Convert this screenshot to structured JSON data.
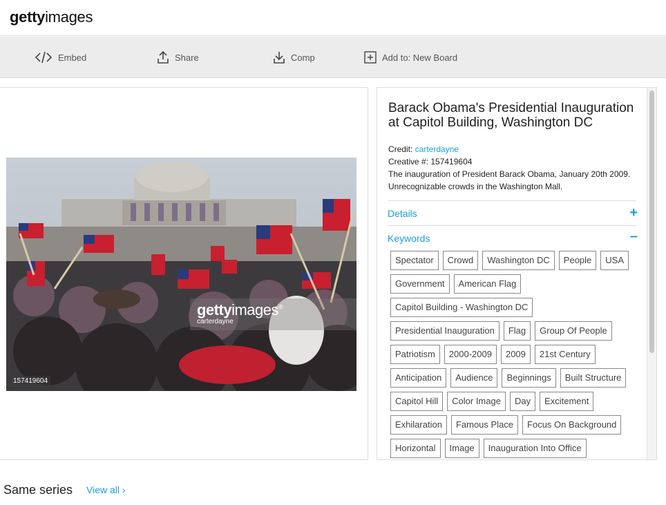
{
  "header": {
    "logo_bold": "getty",
    "logo_light": "images"
  },
  "toolbar": {
    "embed_label": "Embed",
    "share_label": "Share",
    "comp_label": "Comp",
    "board_label": "Add to: New Board"
  },
  "image": {
    "watermark_bold": "getty",
    "watermark_light": "images",
    "watermark_reg": "®",
    "watermark_credit": "carterdayne",
    "id_badge": "157419604"
  },
  "info": {
    "title": "Barack Obama's Presidential Inauguration at Capitol Building, Washington DC",
    "credit_label": "Credit: ",
    "credit_value": "carterdayne",
    "creative_label": "Creative #: ",
    "creative_value": "157419604",
    "description": "The inauguration of President Barack Obama, January 20th 2009. Unrecognizable crowds in the Washington Mall.",
    "details_label": "Details",
    "details_toggle": "+",
    "keywords_label": "Keywords",
    "keywords_toggle": "–"
  },
  "keywords": [
    [
      "Spectator",
      "Crowd",
      "Washington DC",
      "People",
      "USA"
    ],
    [
      "Government",
      "American Flag"
    ],
    [
      "Capitol Building - Washington DC"
    ],
    [
      "Presidential Inauguration",
      "Flag",
      "Group Of People"
    ],
    [
      "Patriotism",
      "2000-2009",
      "2009",
      "21st Century"
    ],
    [
      "Anticipation",
      "Audience",
      "Beginnings",
      "Built Structure"
    ],
    [
      "Capitol Hill",
      "Color Image",
      "Day",
      "Excitement"
    ],
    [
      "Exhilaration",
      "Famous Place",
      "Focus On Background"
    ],
    [
      "Horizontal",
      "Image",
      "Inauguration Into Office"
    ]
  ],
  "series": {
    "title": "Same series",
    "view_all": "View all ›"
  },
  "colors": {
    "accent": "#1a9edb",
    "toolbar_bg": "#ececec"
  }
}
